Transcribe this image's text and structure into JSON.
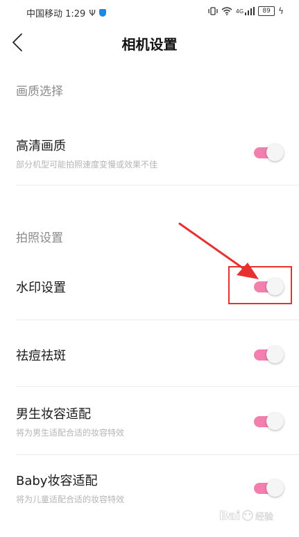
{
  "status_bar": {
    "carrier_time": "中国移动 1:29",
    "network": "4G",
    "battery": "89"
  },
  "header": {
    "title": "相机设置"
  },
  "sections": [
    {
      "title": "画质选择"
    },
    {
      "title": "拍照设置"
    }
  ],
  "settings": [
    {
      "label": "高清画质",
      "subtitle": "部分机型可能拍照速度变慢或效果不佳",
      "enabled": true
    },
    {
      "label": "水印设置",
      "subtitle": "",
      "enabled": true
    },
    {
      "label": "祛痘祛斑",
      "subtitle": "",
      "enabled": true
    },
    {
      "label": "男生妆容适配",
      "subtitle": "将为男生适配合适的妆容特效",
      "enabled": true
    },
    {
      "label": "Baby妆容适配",
      "subtitle": "将为儿童适配合适的妆容特效",
      "enabled": true
    }
  ],
  "colors": {
    "toggle_on": "#f27fae",
    "annotation": "#e8302f"
  }
}
